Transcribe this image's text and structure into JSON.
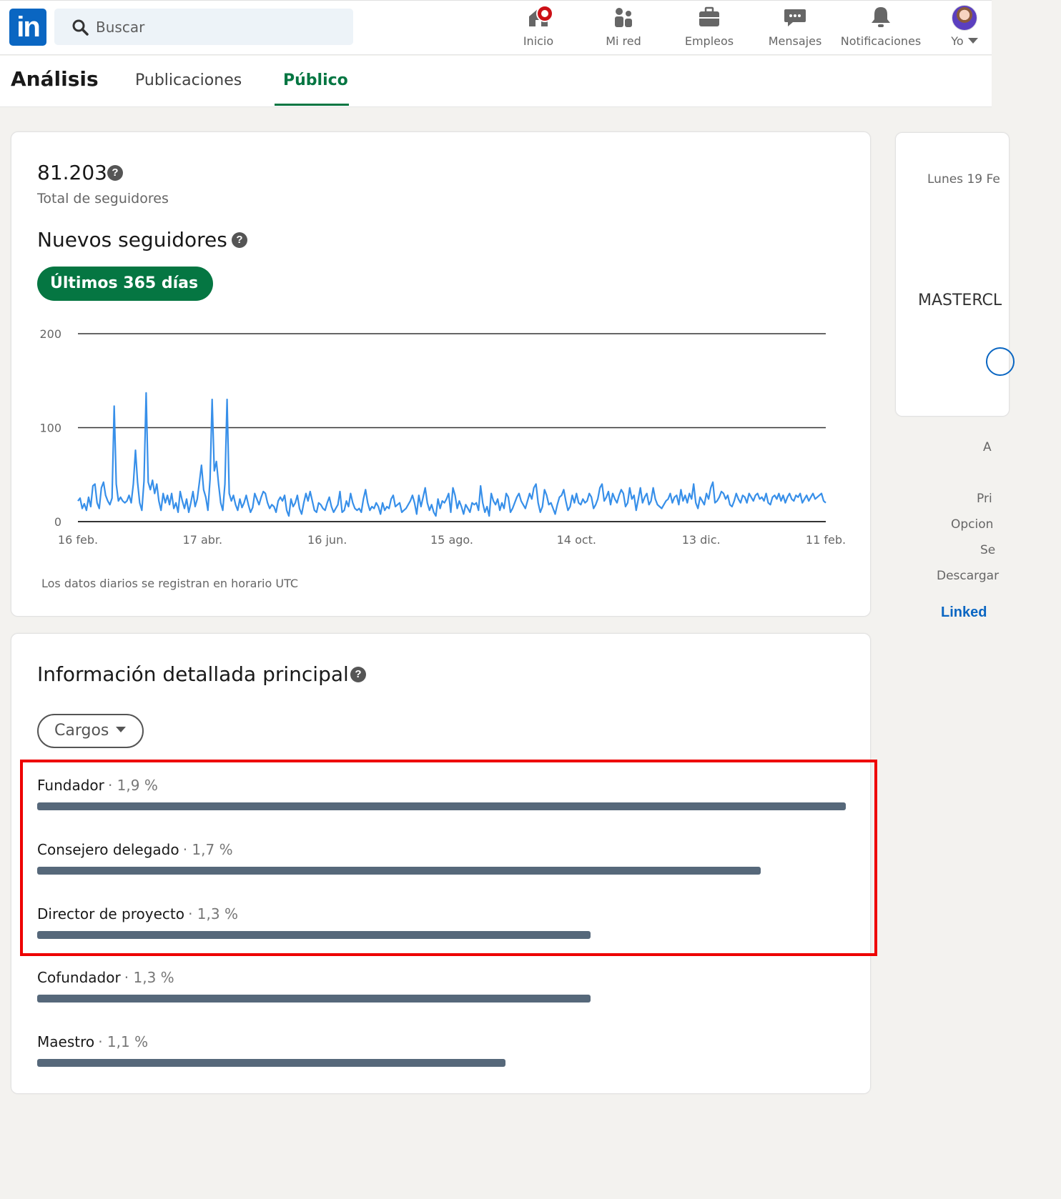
{
  "nav": {
    "logo_text": "in",
    "search_placeholder": "Buscar",
    "items": [
      {
        "label": "Inicio",
        "icon": "home-icon"
      },
      {
        "label": "Mi red",
        "icon": "people-icon"
      },
      {
        "label": "Empleos",
        "icon": "briefcase-icon"
      },
      {
        "label": "Mensajes",
        "icon": "chat-icon"
      },
      {
        "label": "Notificaciones",
        "icon": "bell-icon"
      },
      {
        "label": "Yo",
        "icon": "avatar"
      }
    ]
  },
  "subnav": {
    "title": "Análisis",
    "tabs": [
      {
        "label": "Publicaciones",
        "active": false
      },
      {
        "label": "Público",
        "active": true
      }
    ]
  },
  "followers": {
    "total": "81.203",
    "total_label": "Total de seguidores",
    "new_title": "Nuevos seguidores",
    "range_label": "Últimos 365 días",
    "footnote": "Los datos diarios se registran en horario UTC"
  },
  "chart_data": {
    "type": "line",
    "title": "",
    "xlabel": "",
    "ylabel": "",
    "ylim": [
      0,
      200
    ],
    "yticks": [
      0,
      100,
      200
    ],
    "xticks": [
      "16 feb.",
      "17 abr.",
      "16 jun.",
      "15 ago.",
      "14 oct.",
      "13 dic.",
      "11 feb."
    ],
    "grid": true,
    "color": "#378fe9",
    "series": [
      {
        "values": [
          22,
          25,
          14,
          19,
          12,
          26,
          16,
          38,
          40,
          20,
          14,
          36,
          42,
          28,
          22,
          18,
          25,
          123,
          40,
          22,
          26,
          22,
          20,
          22,
          28,
          20,
          40,
          76,
          42,
          20,
          12,
          43,
          137,
          42,
          34,
          44,
          30,
          40,
          22,
          12,
          30,
          20,
          28,
          18,
          30,
          14,
          20,
          10,
          32,
          22,
          14,
          24,
          10,
          20,
          32,
          16,
          24,
          42,
          60,
          34,
          26,
          12,
          45,
          130,
          54,
          64,
          40,
          20,
          12,
          40,
          130,
          30,
          22,
          28,
          18,
          12,
          24,
          15,
          20,
          28,
          18,
          10,
          15,
          30,
          24,
          18,
          26,
          32,
          30,
          20,
          14,
          18,
          16,
          10,
          22,
          26,
          22,
          28,
          12,
          6,
          24,
          16,
          20,
          28,
          14,
          8,
          20,
          30,
          22,
          32,
          22,
          12,
          10,
          20,
          18,
          14,
          12,
          20,
          26,
          16,
          10,
          14,
          18,
          32,
          10,
          12,
          22,
          16,
          30,
          20,
          14,
          12,
          14,
          10,
          24,
          34,
          20,
          12,
          16,
          14,
          20,
          16,
          8,
          20,
          12,
          16,
          14,
          24,
          28,
          16,
          18,
          20,
          10,
          12,
          14,
          18,
          22,
          28,
          20,
          8,
          28,
          16,
          26,
          36,
          20,
          12,
          18,
          10,
          6,
          24,
          14,
          22,
          20,
          24,
          30,
          10,
          36,
          28,
          14,
          22,
          16,
          8,
          18,
          14,
          10,
          20,
          18,
          20,
          12,
          38,
          20,
          10,
          16,
          6,
          30,
          22,
          18,
          24,
          12,
          20,
          14,
          30,
          26,
          10,
          14,
          20,
          26,
          30,
          22,
          18,
          14,
          22,
          30,
          24,
          36,
          40,
          20,
          10,
          16,
          34,
          28,
          18,
          20,
          14,
          8,
          18,
          26,
          28,
          34,
          22,
          12,
          16,
          28,
          20,
          30,
          20,
          18,
          24,
          20,
          22,
          30,
          26,
          14,
          18,
          24,
          36,
          40,
          22,
          26,
          32,
          18,
          30,
          24,
          20,
          28,
          34,
          30,
          16,
          20,
          36,
          24,
          28,
          12,
          24,
          36,
          20,
          26,
          30,
          18,
          22,
          36,
          24,
          18,
          16,
          14,
          18,
          22,
          24,
          30,
          20,
          26,
          28,
          18,
          34,
          22,
          28,
          20,
          30,
          24,
          40,
          20,
          14,
          26,
          22,
          18,
          30,
          24,
          36,
          42,
          20,
          22,
          26,
          32,
          30,
          24,
          28,
          18,
          16,
          22,
          30,
          24,
          20,
          28,
          26,
          20,
          30,
          26,
          22,
          28,
          30,
          24,
          26,
          22,
          30,
          20,
          18,
          26,
          28,
          24,
          30,
          22,
          28,
          20,
          26,
          30,
          24,
          22,
          28,
          26,
          30,
          20,
          24,
          28,
          22,
          26,
          30,
          24,
          26,
          28,
          30,
          22,
          20
        ],
        "note_ignore": ""
      }
    ]
  },
  "insights": {
    "title": "Información detallada principal",
    "filter_label": "Cargos",
    "rows": [
      {
        "name": "Fundador",
        "pct": "· 1,9 %",
        "value": 1.9
      },
      {
        "name": "Consejero delegado",
        "pct": "· 1,7 %",
        "value": 1.7
      },
      {
        "name": "Director de proyecto",
        "pct": "· 1,3 %",
        "value": 1.3
      },
      {
        "name": "Cofundador",
        "pct": "· 1,3 %",
        "value": 1.3
      },
      {
        "name": "Maestro",
        "pct": "· 1,1 %",
        "value": 1.1
      }
    ]
  },
  "sidebar": {
    "date": "Lunes 19 Fe",
    "headline": "MASTERCL",
    "links": [
      "A",
      "Pri",
      "Opcion",
      "Se",
      "Descargar"
    ],
    "brand": "Linked"
  },
  "colors": {
    "brand": "#0a66c2",
    "accent_green": "#057642",
    "bar": "#56687a",
    "highlight": "#ee0000"
  }
}
